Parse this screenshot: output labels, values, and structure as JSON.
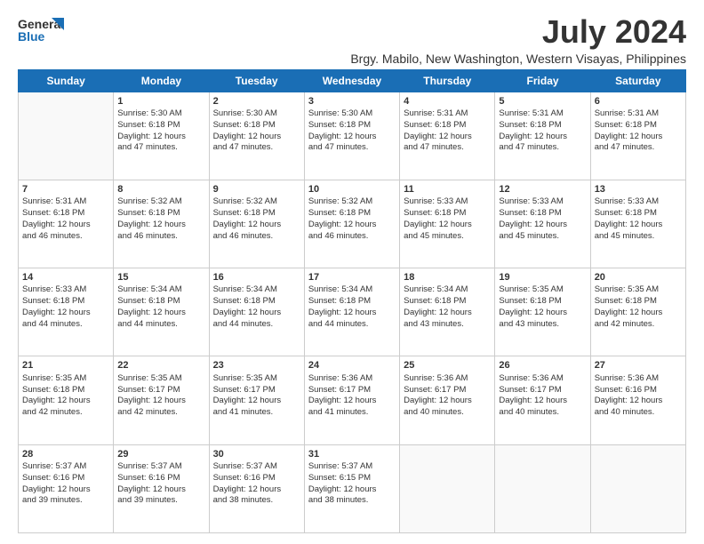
{
  "header": {
    "logo_line1": "General",
    "logo_line2": "Blue",
    "main_title": "July 2024",
    "subtitle": "Brgy. Mabilo, New Washington, Western Visayas, Philippines"
  },
  "days_of_week": [
    "Sunday",
    "Monday",
    "Tuesday",
    "Wednesday",
    "Thursday",
    "Friday",
    "Saturday"
  ],
  "weeks": [
    [
      {
        "day": "",
        "info": ""
      },
      {
        "day": "1",
        "info": "Sunrise: 5:30 AM\nSunset: 6:18 PM\nDaylight: 12 hours\nand 47 minutes."
      },
      {
        "day": "2",
        "info": "Sunrise: 5:30 AM\nSunset: 6:18 PM\nDaylight: 12 hours\nand 47 minutes."
      },
      {
        "day": "3",
        "info": "Sunrise: 5:30 AM\nSunset: 6:18 PM\nDaylight: 12 hours\nand 47 minutes."
      },
      {
        "day": "4",
        "info": "Sunrise: 5:31 AM\nSunset: 6:18 PM\nDaylight: 12 hours\nand 47 minutes."
      },
      {
        "day": "5",
        "info": "Sunrise: 5:31 AM\nSunset: 6:18 PM\nDaylight: 12 hours\nand 47 minutes."
      },
      {
        "day": "6",
        "info": "Sunrise: 5:31 AM\nSunset: 6:18 PM\nDaylight: 12 hours\nand 47 minutes."
      }
    ],
    [
      {
        "day": "7",
        "info": "Sunrise: 5:31 AM\nSunset: 6:18 PM\nDaylight: 12 hours\nand 46 minutes."
      },
      {
        "day": "8",
        "info": "Sunrise: 5:32 AM\nSunset: 6:18 PM\nDaylight: 12 hours\nand 46 minutes."
      },
      {
        "day": "9",
        "info": "Sunrise: 5:32 AM\nSunset: 6:18 PM\nDaylight: 12 hours\nand 46 minutes."
      },
      {
        "day": "10",
        "info": "Sunrise: 5:32 AM\nSunset: 6:18 PM\nDaylight: 12 hours\nand 46 minutes."
      },
      {
        "day": "11",
        "info": "Sunrise: 5:33 AM\nSunset: 6:18 PM\nDaylight: 12 hours\nand 45 minutes."
      },
      {
        "day": "12",
        "info": "Sunrise: 5:33 AM\nSunset: 6:18 PM\nDaylight: 12 hours\nand 45 minutes."
      },
      {
        "day": "13",
        "info": "Sunrise: 5:33 AM\nSunset: 6:18 PM\nDaylight: 12 hours\nand 45 minutes."
      }
    ],
    [
      {
        "day": "14",
        "info": "Sunrise: 5:33 AM\nSunset: 6:18 PM\nDaylight: 12 hours\nand 44 minutes."
      },
      {
        "day": "15",
        "info": "Sunrise: 5:34 AM\nSunset: 6:18 PM\nDaylight: 12 hours\nand 44 minutes."
      },
      {
        "day": "16",
        "info": "Sunrise: 5:34 AM\nSunset: 6:18 PM\nDaylight: 12 hours\nand 44 minutes."
      },
      {
        "day": "17",
        "info": "Sunrise: 5:34 AM\nSunset: 6:18 PM\nDaylight: 12 hours\nand 44 minutes."
      },
      {
        "day": "18",
        "info": "Sunrise: 5:34 AM\nSunset: 6:18 PM\nDaylight: 12 hours\nand 43 minutes."
      },
      {
        "day": "19",
        "info": "Sunrise: 5:35 AM\nSunset: 6:18 PM\nDaylight: 12 hours\nand 43 minutes."
      },
      {
        "day": "20",
        "info": "Sunrise: 5:35 AM\nSunset: 6:18 PM\nDaylight: 12 hours\nand 42 minutes."
      }
    ],
    [
      {
        "day": "21",
        "info": "Sunrise: 5:35 AM\nSunset: 6:18 PM\nDaylight: 12 hours\nand 42 minutes."
      },
      {
        "day": "22",
        "info": "Sunrise: 5:35 AM\nSunset: 6:17 PM\nDaylight: 12 hours\nand 42 minutes."
      },
      {
        "day": "23",
        "info": "Sunrise: 5:35 AM\nSunset: 6:17 PM\nDaylight: 12 hours\nand 41 minutes."
      },
      {
        "day": "24",
        "info": "Sunrise: 5:36 AM\nSunset: 6:17 PM\nDaylight: 12 hours\nand 41 minutes."
      },
      {
        "day": "25",
        "info": "Sunrise: 5:36 AM\nSunset: 6:17 PM\nDaylight: 12 hours\nand 40 minutes."
      },
      {
        "day": "26",
        "info": "Sunrise: 5:36 AM\nSunset: 6:17 PM\nDaylight: 12 hours\nand 40 minutes."
      },
      {
        "day": "27",
        "info": "Sunrise: 5:36 AM\nSunset: 6:16 PM\nDaylight: 12 hours\nand 40 minutes."
      }
    ],
    [
      {
        "day": "28",
        "info": "Sunrise: 5:37 AM\nSunset: 6:16 PM\nDaylight: 12 hours\nand 39 minutes."
      },
      {
        "day": "29",
        "info": "Sunrise: 5:37 AM\nSunset: 6:16 PM\nDaylight: 12 hours\nand 39 minutes."
      },
      {
        "day": "30",
        "info": "Sunrise: 5:37 AM\nSunset: 6:16 PM\nDaylight: 12 hours\nand 38 minutes."
      },
      {
        "day": "31",
        "info": "Sunrise: 5:37 AM\nSunset: 6:15 PM\nDaylight: 12 hours\nand 38 minutes."
      },
      {
        "day": "",
        "info": ""
      },
      {
        "day": "",
        "info": ""
      },
      {
        "day": "",
        "info": ""
      }
    ]
  ]
}
